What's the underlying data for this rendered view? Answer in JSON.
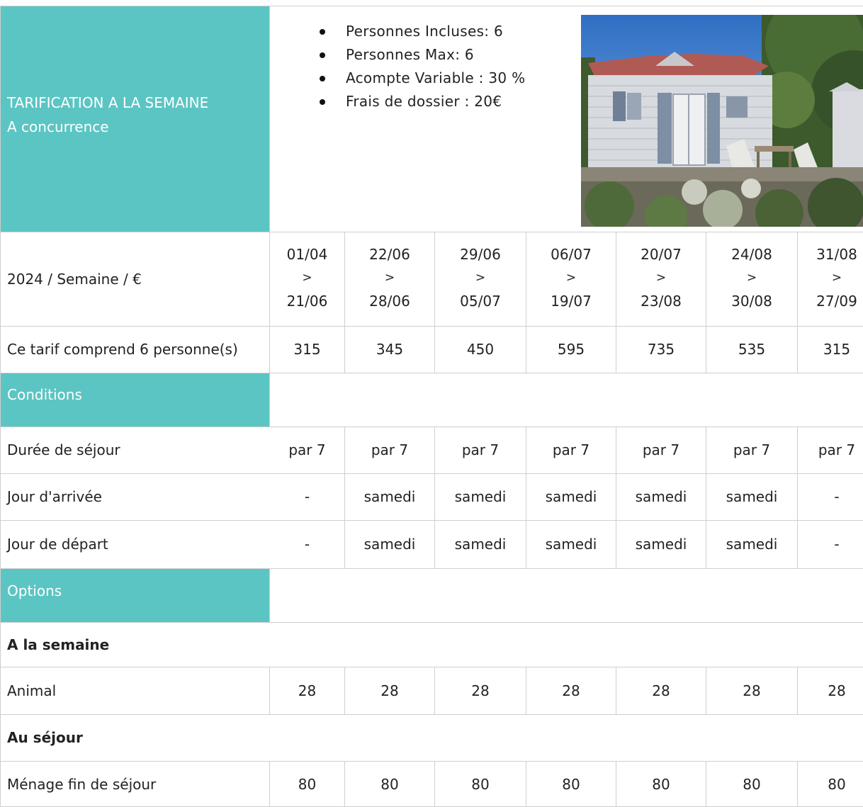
{
  "header": {
    "title": "TARIFICATION A LA SEMAINE",
    "subtitle": "A concurrence"
  },
  "info": [
    "Personnes Incluses: 6",
    "Personnes Max: 6",
    "Acompte Variable : 30 %",
    "Frais de dossier : 20€"
  ],
  "photo": {
    "icon": "mobile-home-photo"
  },
  "periods_label": "2024 / Semaine / €",
  "periods": [
    {
      "start": "01/04",
      "sep": ">",
      "end": "21/06"
    },
    {
      "start": "22/06",
      "sep": ">",
      "end": "28/06"
    },
    {
      "start": "29/06",
      "sep": ">",
      "end": "05/07"
    },
    {
      "start": "06/07",
      "sep": ">",
      "end": "19/07"
    },
    {
      "start": "20/07",
      "sep": ">",
      "end": "23/08"
    },
    {
      "start": "24/08",
      "sep": ">",
      "end": "30/08"
    },
    {
      "start": "31/08",
      "sep": ">",
      "end": "27/09"
    }
  ],
  "price_row": {
    "label": "Ce tarif comprend 6 personne(s)",
    "values": [
      "315",
      "345",
      "450",
      "595",
      "735",
      "535",
      "315"
    ]
  },
  "conditions": {
    "title": "Conditions",
    "rows": [
      {
        "label": "Durée de séjour",
        "values": [
          "par 7",
          "par 7",
          "par 7",
          "par 7",
          "par 7",
          "par 7",
          "par 7"
        ]
      },
      {
        "label": "Jour d'arrivée",
        "values": [
          "-",
          "samedi",
          "samedi",
          "samedi",
          "samedi",
          "samedi",
          "-"
        ]
      },
      {
        "label": "Jour de départ",
        "values": [
          "-",
          "samedi",
          "samedi",
          "samedi",
          "samedi",
          "samedi",
          "-"
        ]
      }
    ]
  },
  "options": {
    "title": "Options",
    "week_heading": "A la semaine",
    "week_rows": [
      {
        "label": "Animal",
        "values": [
          "28",
          "28",
          "28",
          "28",
          "28",
          "28",
          "28"
        ]
      }
    ],
    "stay_heading": "Au séjour",
    "stay_rows": [
      {
        "label": "Ménage fin de séjour",
        "values": [
          "80",
          "80",
          "80",
          "80",
          "80",
          "80",
          "80"
        ]
      }
    ]
  },
  "colors": {
    "accent": "#5bc5c3",
    "grid": "#cfcfcf",
    "text": "#222222"
  }
}
